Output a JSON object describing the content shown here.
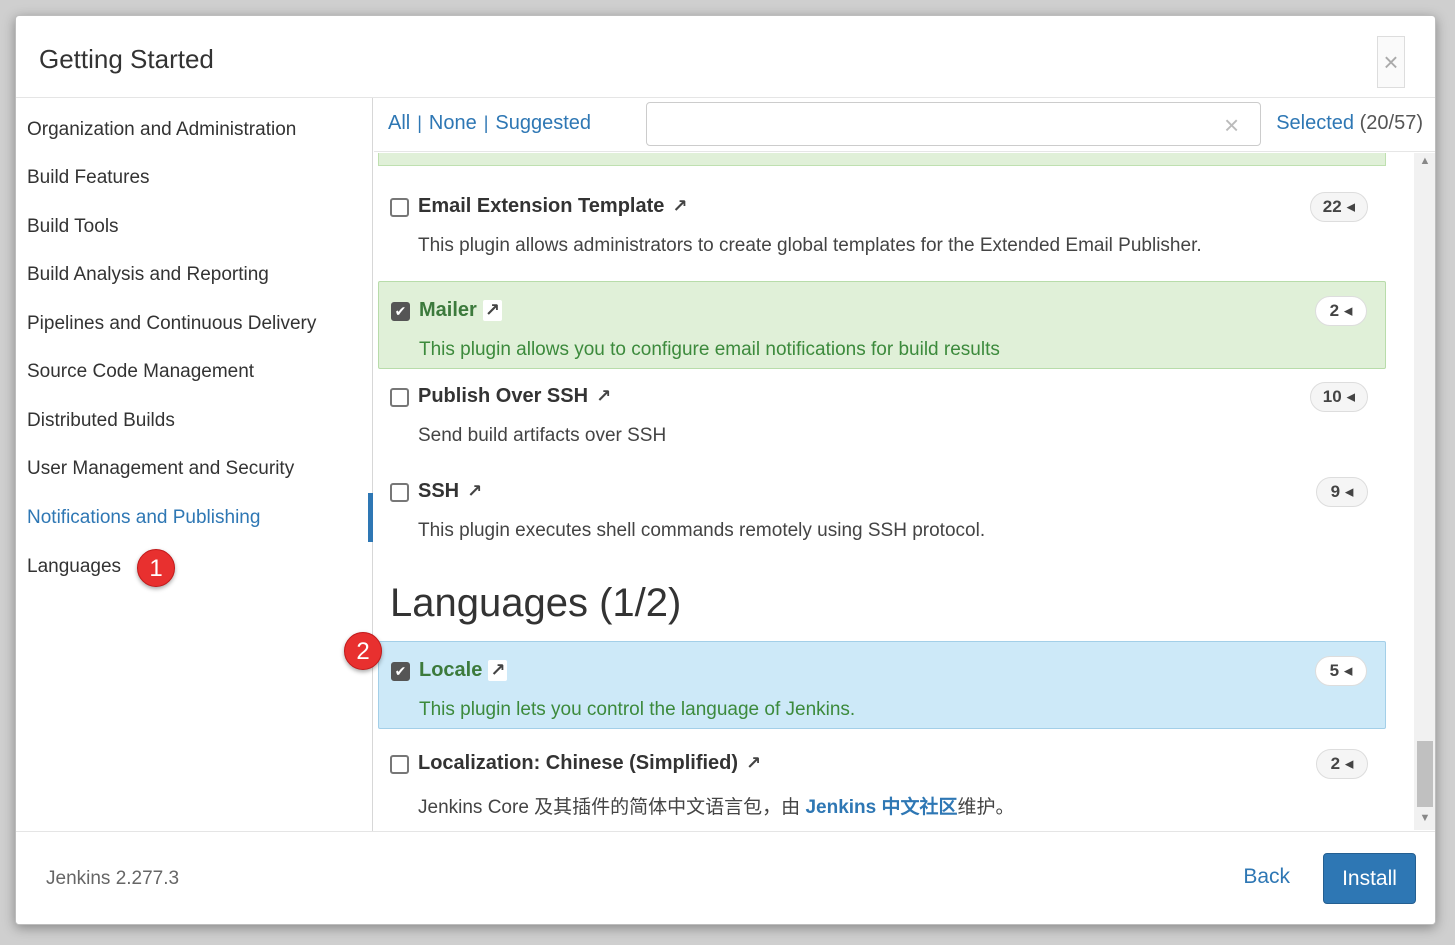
{
  "dialog": {
    "title": "Getting Started",
    "close_label": "×"
  },
  "sidebar": {
    "items": [
      {
        "label": "Organization and Administration"
      },
      {
        "label": "Build Features"
      },
      {
        "label": "Build Tools"
      },
      {
        "label": "Build Analysis and Reporting"
      },
      {
        "label": "Pipelines and Continuous Delivery"
      },
      {
        "label": "Source Code Management"
      },
      {
        "label": "Distributed Builds"
      },
      {
        "label": "User Management and Security"
      },
      {
        "label": "Notifications and Publishing",
        "active": true
      },
      {
        "label": "Languages"
      }
    ]
  },
  "annotations": {
    "badge1": "1",
    "badge2": "2"
  },
  "toolbar": {
    "all": "All",
    "none": "None",
    "suggested": "Suggested",
    "search_value": "",
    "search_clear": "×",
    "selected_label": "Selected",
    "selected_count": "(20/57)"
  },
  "plugins": [
    {
      "name": "Email Extension Template",
      "checked": false,
      "deps": "22",
      "description": "This plugin allows administrators to create global templates for the Extended Email Publisher."
    },
    {
      "name": "Mailer",
      "checked": true,
      "deps": "2",
      "description": "This plugin allows you to configure email notifications for build results"
    },
    {
      "name": "Publish Over SSH",
      "checked": false,
      "deps": "10",
      "description": "Send build artifacts over SSH"
    },
    {
      "name": "SSH",
      "checked": false,
      "deps": "9",
      "description": "This plugin executes shell commands remotely using SSH protocol."
    }
  ],
  "languages_section": {
    "title": "Languages (1/2)",
    "plugins": [
      {
        "name": "Locale",
        "checked": true,
        "deps": "5",
        "description": "This plugin lets you control the language of Jenkins."
      },
      {
        "name": "Localization: Chinese (Simplified)",
        "checked": false,
        "deps": "2",
        "description_pre": "Jenkins Core 及其插件的简体中文语言包，由 ",
        "description_link": "Jenkins 中文社区",
        "description_post": "维护。"
      }
    ]
  },
  "icons": {
    "external_link": "↗",
    "dep_caret": "◂",
    "checkmark": "✔",
    "scroll_up": "▲",
    "scroll_down": "▼"
  },
  "footer": {
    "version": "Jenkins 2.277.3",
    "back": "Back",
    "install": "Install"
  },
  "colors": {
    "accent": "#2e77b4",
    "selected_green": "#e0f0d8",
    "selected_blue": "#cde9f8",
    "badge_red": "#e8302f"
  }
}
